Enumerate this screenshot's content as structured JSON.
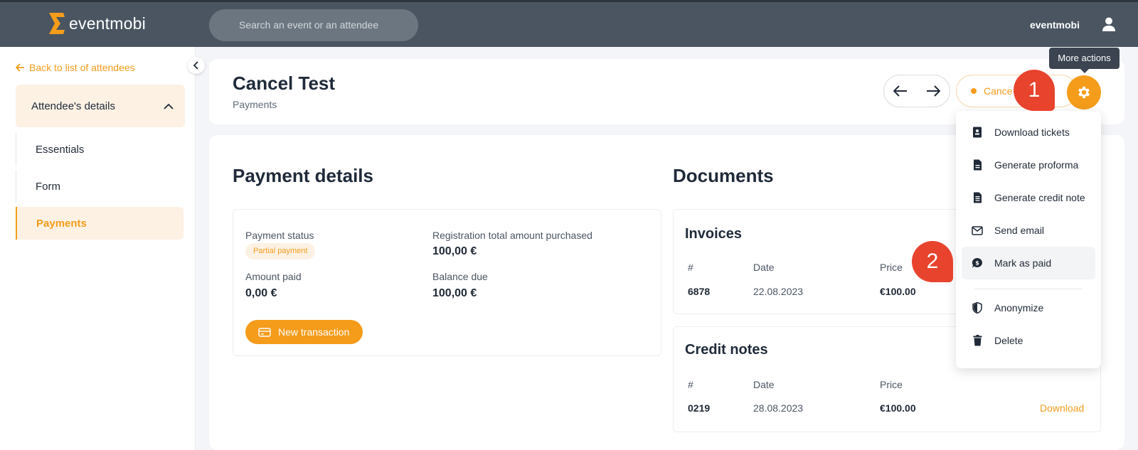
{
  "topbar": {
    "logo_text": "eventmobi",
    "search_placeholder": "Search an event or an attendee",
    "user_name": "eventmobi"
  },
  "sidebar": {
    "back_label": "Back to list of attendees",
    "section_title": "Attendee's details",
    "items": [
      {
        "label": "Essentials"
      },
      {
        "label": "Form"
      },
      {
        "label": "Payments"
      }
    ]
  },
  "header": {
    "title": "Cancel Test",
    "subtitle": "Payments",
    "status_label": "Cance",
    "tooltip": "More actions"
  },
  "callouts": [
    "1",
    "2"
  ],
  "payment": {
    "heading": "Payment details",
    "status_label": "Payment status",
    "status_badge": "Partial payment",
    "total_label": "Registration total amount purchased",
    "total_value": "100,00 €",
    "paid_label": "Amount paid",
    "paid_value": "0,00 €",
    "balance_label": "Balance due",
    "balance_value": "100,00 €",
    "new_tx_label": "New transaction"
  },
  "documents": {
    "heading": "Documents",
    "columns": [
      "#",
      "Date",
      "Price"
    ],
    "invoices": {
      "title": "Invoices",
      "rows": [
        {
          "num": "6878",
          "date": "22.08.2023",
          "price": "€100.00"
        }
      ]
    },
    "credit_notes": {
      "title": "Credit notes",
      "rows": [
        {
          "num": "0219",
          "date": "28.08.2023",
          "price": "€100.00",
          "action": "Download"
        }
      ]
    }
  },
  "menu": {
    "items": [
      {
        "label": "Download tickets",
        "icon": "ticket-icon"
      },
      {
        "label": "Generate proforma",
        "icon": "document-icon"
      },
      {
        "label": "Generate credit note",
        "icon": "document-lines-icon"
      },
      {
        "label": "Send email",
        "icon": "envelope-icon"
      },
      {
        "label": "Mark as paid",
        "icon": "money-bubble-icon"
      },
      {
        "label": "Anonymize",
        "icon": "shield-icon"
      },
      {
        "label": "Delete",
        "icon": "trash-icon"
      }
    ]
  },
  "colors": {
    "accent": "#f59c1b",
    "topbar": "#4a5561",
    "callout": "#e8432d"
  }
}
